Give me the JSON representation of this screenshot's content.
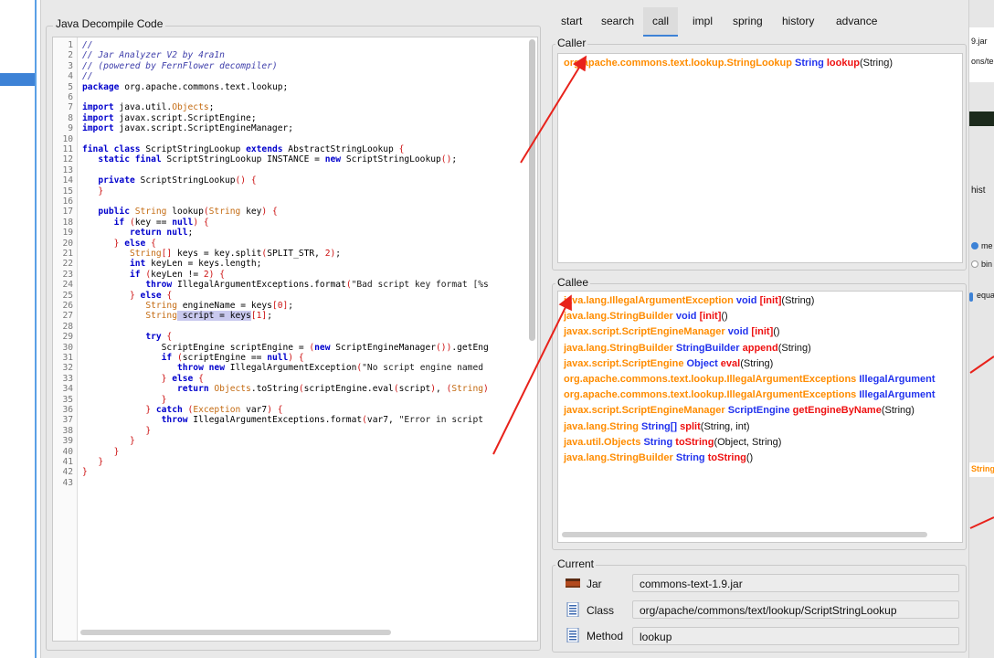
{
  "decompile": {
    "title": "Java Decompile Code",
    "lines": [
      {
        "n": "1",
        "t": "//",
        "c": "cm"
      },
      {
        "n": "2",
        "t": "// Jar Analyzer V2 by 4ra1n",
        "c": "cm"
      },
      {
        "n": "3",
        "t": "// (powered by FernFlower decompiler)",
        "c": "cm"
      },
      {
        "n": "4",
        "t": "//",
        "c": "cm"
      },
      {
        "n": "5",
        "t": "package org.apache.commons.text.lookup;",
        "c": ""
      },
      {
        "n": "6",
        "t": "",
        "c": ""
      },
      {
        "n": "7",
        "t": "import java.util.Objects;",
        "c": ""
      },
      {
        "n": "8",
        "t": "import javax.script.ScriptEngine;",
        "c": ""
      },
      {
        "n": "9",
        "t": "import javax.script.ScriptEngineManager;",
        "c": ""
      },
      {
        "n": "10",
        "t": "",
        "c": ""
      },
      {
        "n": "11",
        "t": "final class ScriptStringLookup extends AbstractStringLookup {",
        "c": ""
      },
      {
        "n": "12",
        "t": "   static final ScriptStringLookup INSTANCE = new ScriptStringLookup();",
        "c": ""
      },
      {
        "n": "13",
        "t": "",
        "c": ""
      },
      {
        "n": "14",
        "t": "   private ScriptStringLookup() {",
        "c": ""
      },
      {
        "n": "15",
        "t": "   }",
        "c": ""
      },
      {
        "n": "16",
        "t": "",
        "c": ""
      },
      {
        "n": "17",
        "t": "   public String lookup(String key) {",
        "c": ""
      },
      {
        "n": "18",
        "t": "      if (key == null) {",
        "c": ""
      },
      {
        "n": "19",
        "t": "         return null;",
        "c": ""
      },
      {
        "n": "20",
        "t": "      } else {",
        "c": ""
      },
      {
        "n": "21",
        "t": "         String[] keys = key.split(SPLIT_STR, 2);",
        "c": ""
      },
      {
        "n": "22",
        "t": "         int keyLen = keys.length;",
        "c": ""
      },
      {
        "n": "23",
        "t": "         if (keyLen != 2) {",
        "c": ""
      },
      {
        "n": "24",
        "t": "            throw IllegalArgumentExceptions.format(\"Bad script key format [%s",
        "c": ""
      },
      {
        "n": "25",
        "t": "         } else {",
        "c": ""
      },
      {
        "n": "26",
        "t": "            String engineName = keys[0];",
        "c": ""
      },
      {
        "n": "27",
        "t": "            String script = keys[1];",
        "c": ""
      },
      {
        "n": "28",
        "t": "",
        "c": ""
      },
      {
        "n": "29",
        "t": "            try {",
        "c": ""
      },
      {
        "n": "30",
        "t": "               ScriptEngine scriptEngine = (new ScriptEngineManager()).getEng",
        "c": ""
      },
      {
        "n": "31",
        "t": "               if (scriptEngine == null) {",
        "c": ""
      },
      {
        "n": "32",
        "t": "                  throw new IllegalArgumentException(\"No script engine named",
        "c": ""
      },
      {
        "n": "33",
        "t": "               } else {",
        "c": ""
      },
      {
        "n": "34",
        "t": "                  return Objects.toString(scriptEngine.eval(script), (String)",
        "c": ""
      },
      {
        "n": "35",
        "t": "               }",
        "c": ""
      },
      {
        "n": "36",
        "t": "            } catch (Exception var7) {",
        "c": ""
      },
      {
        "n": "37",
        "t": "               throw IllegalArgumentExceptions.format(var7, \"Error in script",
        "c": ""
      },
      {
        "n": "38",
        "t": "            }",
        "c": ""
      },
      {
        "n": "39",
        "t": "         }",
        "c": ""
      },
      {
        "n": "40",
        "t": "      }",
        "c": ""
      },
      {
        "n": "41",
        "t": "   }",
        "c": ""
      },
      {
        "n": "42",
        "t": "}",
        "c": ""
      },
      {
        "n": "43",
        "t": "",
        "c": ""
      }
    ]
  },
  "tabs": [
    "start",
    "search",
    "call",
    "impl",
    "spring",
    "history",
    "advance"
  ],
  "active_tab": "call",
  "caller": {
    "label": "Caller",
    "rows": [
      {
        "pkg": "org.apache.commons.text.lookup.StringLookup",
        "ret": "String",
        "method": "lookup",
        "args": "(String)"
      }
    ]
  },
  "callee": {
    "label": "Callee",
    "rows": [
      {
        "pkg": "java.lang.IllegalArgumentException",
        "ret": "void",
        "method": "[init]",
        "args": "(String)"
      },
      {
        "pkg": "java.lang.StringBuilder",
        "ret": "void",
        "method": "[init]",
        "args": "()"
      },
      {
        "pkg": "javax.script.ScriptEngineManager",
        "ret": "void",
        "method": "[init]",
        "args": "()"
      },
      {
        "pkg": "java.lang.StringBuilder",
        "ret": "StringBuilder",
        "method": "append",
        "args": "(String)"
      },
      {
        "pkg": "javax.script.ScriptEngine",
        "ret": "Object",
        "method": "eval",
        "args": "(String)"
      },
      {
        "pkg": "org.apache.commons.text.lookup.IllegalArgumentExceptions",
        "ret": "IllegalArgument",
        "method": "",
        "args": ""
      },
      {
        "pkg": "org.apache.commons.text.lookup.IllegalArgumentExceptions",
        "ret": "IllegalArgument",
        "method": "",
        "args": ""
      },
      {
        "pkg": "javax.script.ScriptEngineManager",
        "ret": "ScriptEngine",
        "method": "getEngineByName",
        "args": "(String)"
      },
      {
        "pkg": "java.lang.String",
        "ret": "String[]",
        "method": "split",
        "args": "(String, int)"
      },
      {
        "pkg": "java.util.Objects",
        "ret": "String",
        "method": "toString",
        "args": "(Object, String)"
      },
      {
        "pkg": "java.lang.StringBuilder",
        "ret": "String",
        "method": "toString",
        "args": "()"
      }
    ]
  },
  "current": {
    "label": "Current",
    "jar_label": "Jar",
    "jar_value": "commons-text-1.9.jar",
    "class_label": "Class",
    "class_value": "org/apache/commons/text/lookup/ScriptStringLookup",
    "method_label": "Method",
    "method_value": "lookup"
  },
  "right_strip": {
    "jar_fragment": "9.jar",
    "path_fragment": "ons/te",
    "hist_fragment": "hist",
    "opt1": "me",
    "opt2": "bin",
    "opt3": "equal",
    "string_fragment": "String"
  },
  "colors": {
    "package": "#ff8c00",
    "return_type": "#2233ee",
    "method_name": "#ee1111",
    "arrow": "#e8221b",
    "accent": "#3d82d6"
  }
}
